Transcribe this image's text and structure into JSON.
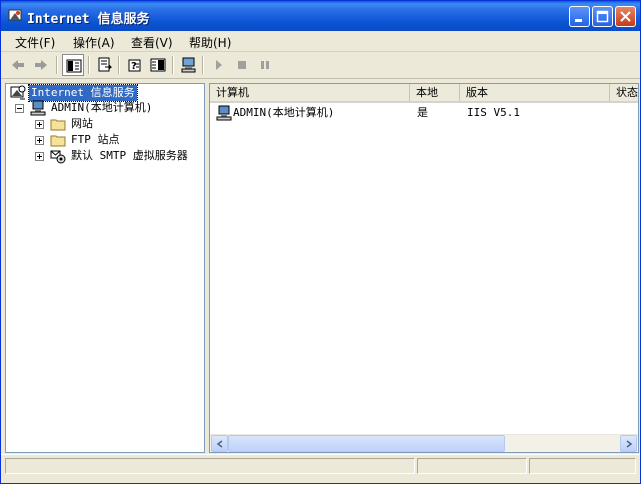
{
  "window": {
    "title": "Internet 信息服务",
    "controls": {
      "minimize": "minimize-icon",
      "maximize": "maximize-icon",
      "close": "close-icon"
    }
  },
  "menu": [
    {
      "label": "文件(F)"
    },
    {
      "label": "操作(A)"
    },
    {
      "label": "查看(V)"
    },
    {
      "label": "帮助(H)"
    }
  ],
  "toolbar": {
    "icons": [
      "back-arrow-icon",
      "forward-arrow-icon",
      "show-tree-icon",
      "export-list-icon",
      "help-properties-icon",
      "detail-view-icon",
      "connect-computer-icon",
      "play-icon",
      "stop-icon",
      "pause-icon"
    ]
  },
  "tree": {
    "root": "Internet 信息服务",
    "computer": "ADMIN(本地计算机)",
    "children": [
      "网站",
      "FTP 站点",
      "默认 SMTP 虚拟服务器"
    ]
  },
  "list": {
    "columns": [
      "计算机",
      "本地",
      "版本",
      "状态"
    ],
    "rows": [
      {
        "computer": "ADMIN(本地计算机)",
        "local": "是",
        "version": "IIS V5.1",
        "status": ""
      }
    ]
  },
  "colors": {
    "title_bar": "#0a55d4",
    "selection": "#316ac5",
    "face": "#ece9d8"
  }
}
